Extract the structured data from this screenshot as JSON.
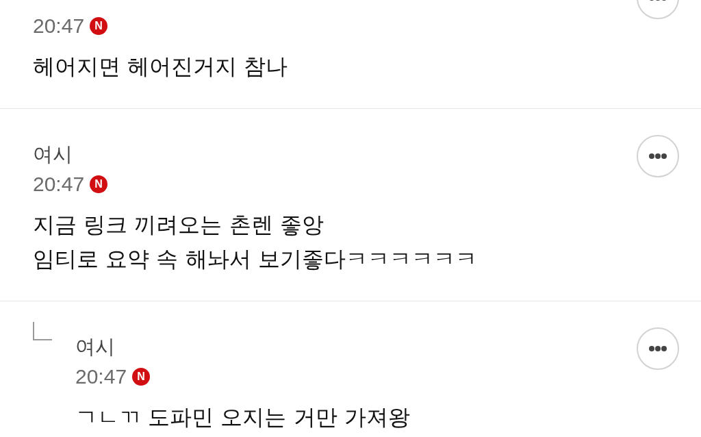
{
  "comments": [
    {
      "time": "20:47",
      "badge": "N",
      "text": "헤어지면 헤어진거지 참나",
      "is_reply": false
    },
    {
      "author": "여시",
      "time": "20:47",
      "badge": "N",
      "text": "지금 링크 끼려오는 촌렌 좋앙\n임티로 요약 속 해놔서 보기좋다ㅋㅋㅋㅋㅋㅋ",
      "is_reply": false
    },
    {
      "author": "여시",
      "time": "20:47",
      "badge": "N",
      "text": "ㄱㄴㄲ 도파민 오지는 거만 가져왕",
      "is_reply": true
    }
  ]
}
